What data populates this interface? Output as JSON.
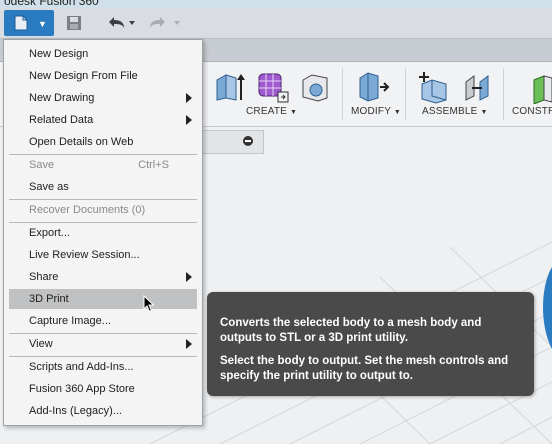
{
  "app": {
    "title": "odesk Fusion 360"
  },
  "ribbon": {
    "groups": [
      {
        "label": "CREATE",
        "caret": "▼"
      },
      {
        "label": "MODIFY",
        "caret": "▼"
      },
      {
        "label": "ASSEMBLE",
        "caret": "▼"
      },
      {
        "label": "CONSTR"
      }
    ]
  },
  "file_menu": {
    "items": [
      {
        "label": "New Design"
      },
      {
        "label": "New Design From File"
      },
      {
        "label": "New Drawing"
      },
      {
        "label": "Related Data"
      },
      {
        "label": "Open Details on Web"
      },
      {
        "label": "Save",
        "shortcut": "Ctrl+S"
      },
      {
        "label": "Save as"
      },
      {
        "label": "Recover Documents (0)"
      },
      {
        "label": "Export..."
      },
      {
        "label": "Live Review Session..."
      },
      {
        "label": "Share"
      },
      {
        "label": "3D Print"
      },
      {
        "label": "Capture Image..."
      },
      {
        "label": "View"
      },
      {
        "label": "Scripts and Add-Ins..."
      },
      {
        "label": "Fusion 360 App Store"
      },
      {
        "label": "Add-Ins (Legacy)..."
      }
    ]
  },
  "tooltip": {
    "lines": [
      "Converts the selected body to a mesh body and",
      "outputs to STL or a 3D print utility.",
      "Select the body to output. Set the mesh controls and",
      "specify the print utility to output to."
    ]
  },
  "colors": {
    "accent": "#2b7bc0",
    "tooltip_bg": "#4a4a4a",
    "menu_hover": "#bfc1c3"
  }
}
